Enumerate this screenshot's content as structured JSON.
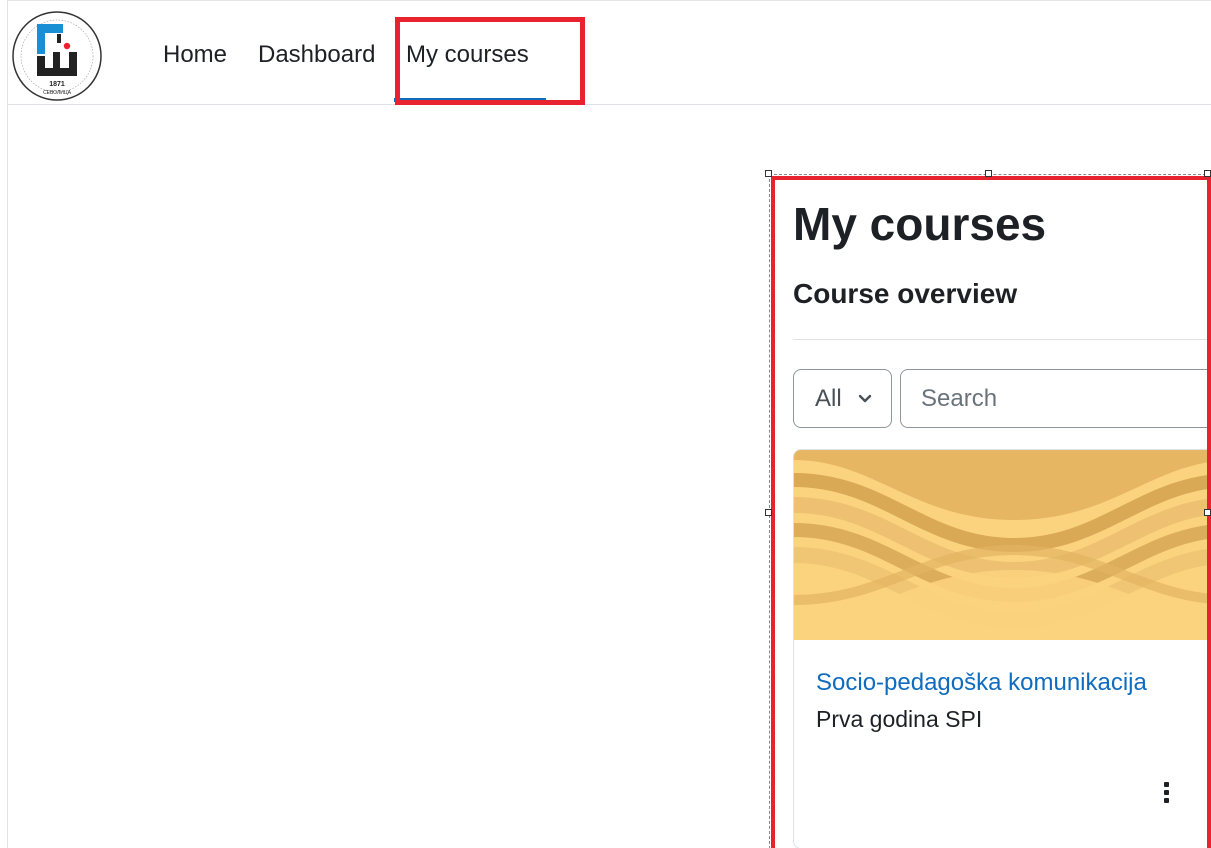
{
  "logo": {
    "year": "1871",
    "city": "СЕВОЛИЦА"
  },
  "nav": {
    "items": [
      {
        "label": "Home"
      },
      {
        "label": "Dashboard"
      },
      {
        "label": "My courses"
      }
    ],
    "active": "My courses"
  },
  "page": {
    "title": "My courses",
    "subtitle": "Course overview"
  },
  "filter": {
    "selected": "All",
    "search_placeholder": "Search"
  },
  "courses": [
    {
      "name": "Socio-pedagoška komunikacija",
      "category": "Prva godina SPI"
    }
  ],
  "colors": {
    "accent": "#0f6cbf",
    "highlight": "#e8232f",
    "card_pattern": "#f8c96e"
  }
}
